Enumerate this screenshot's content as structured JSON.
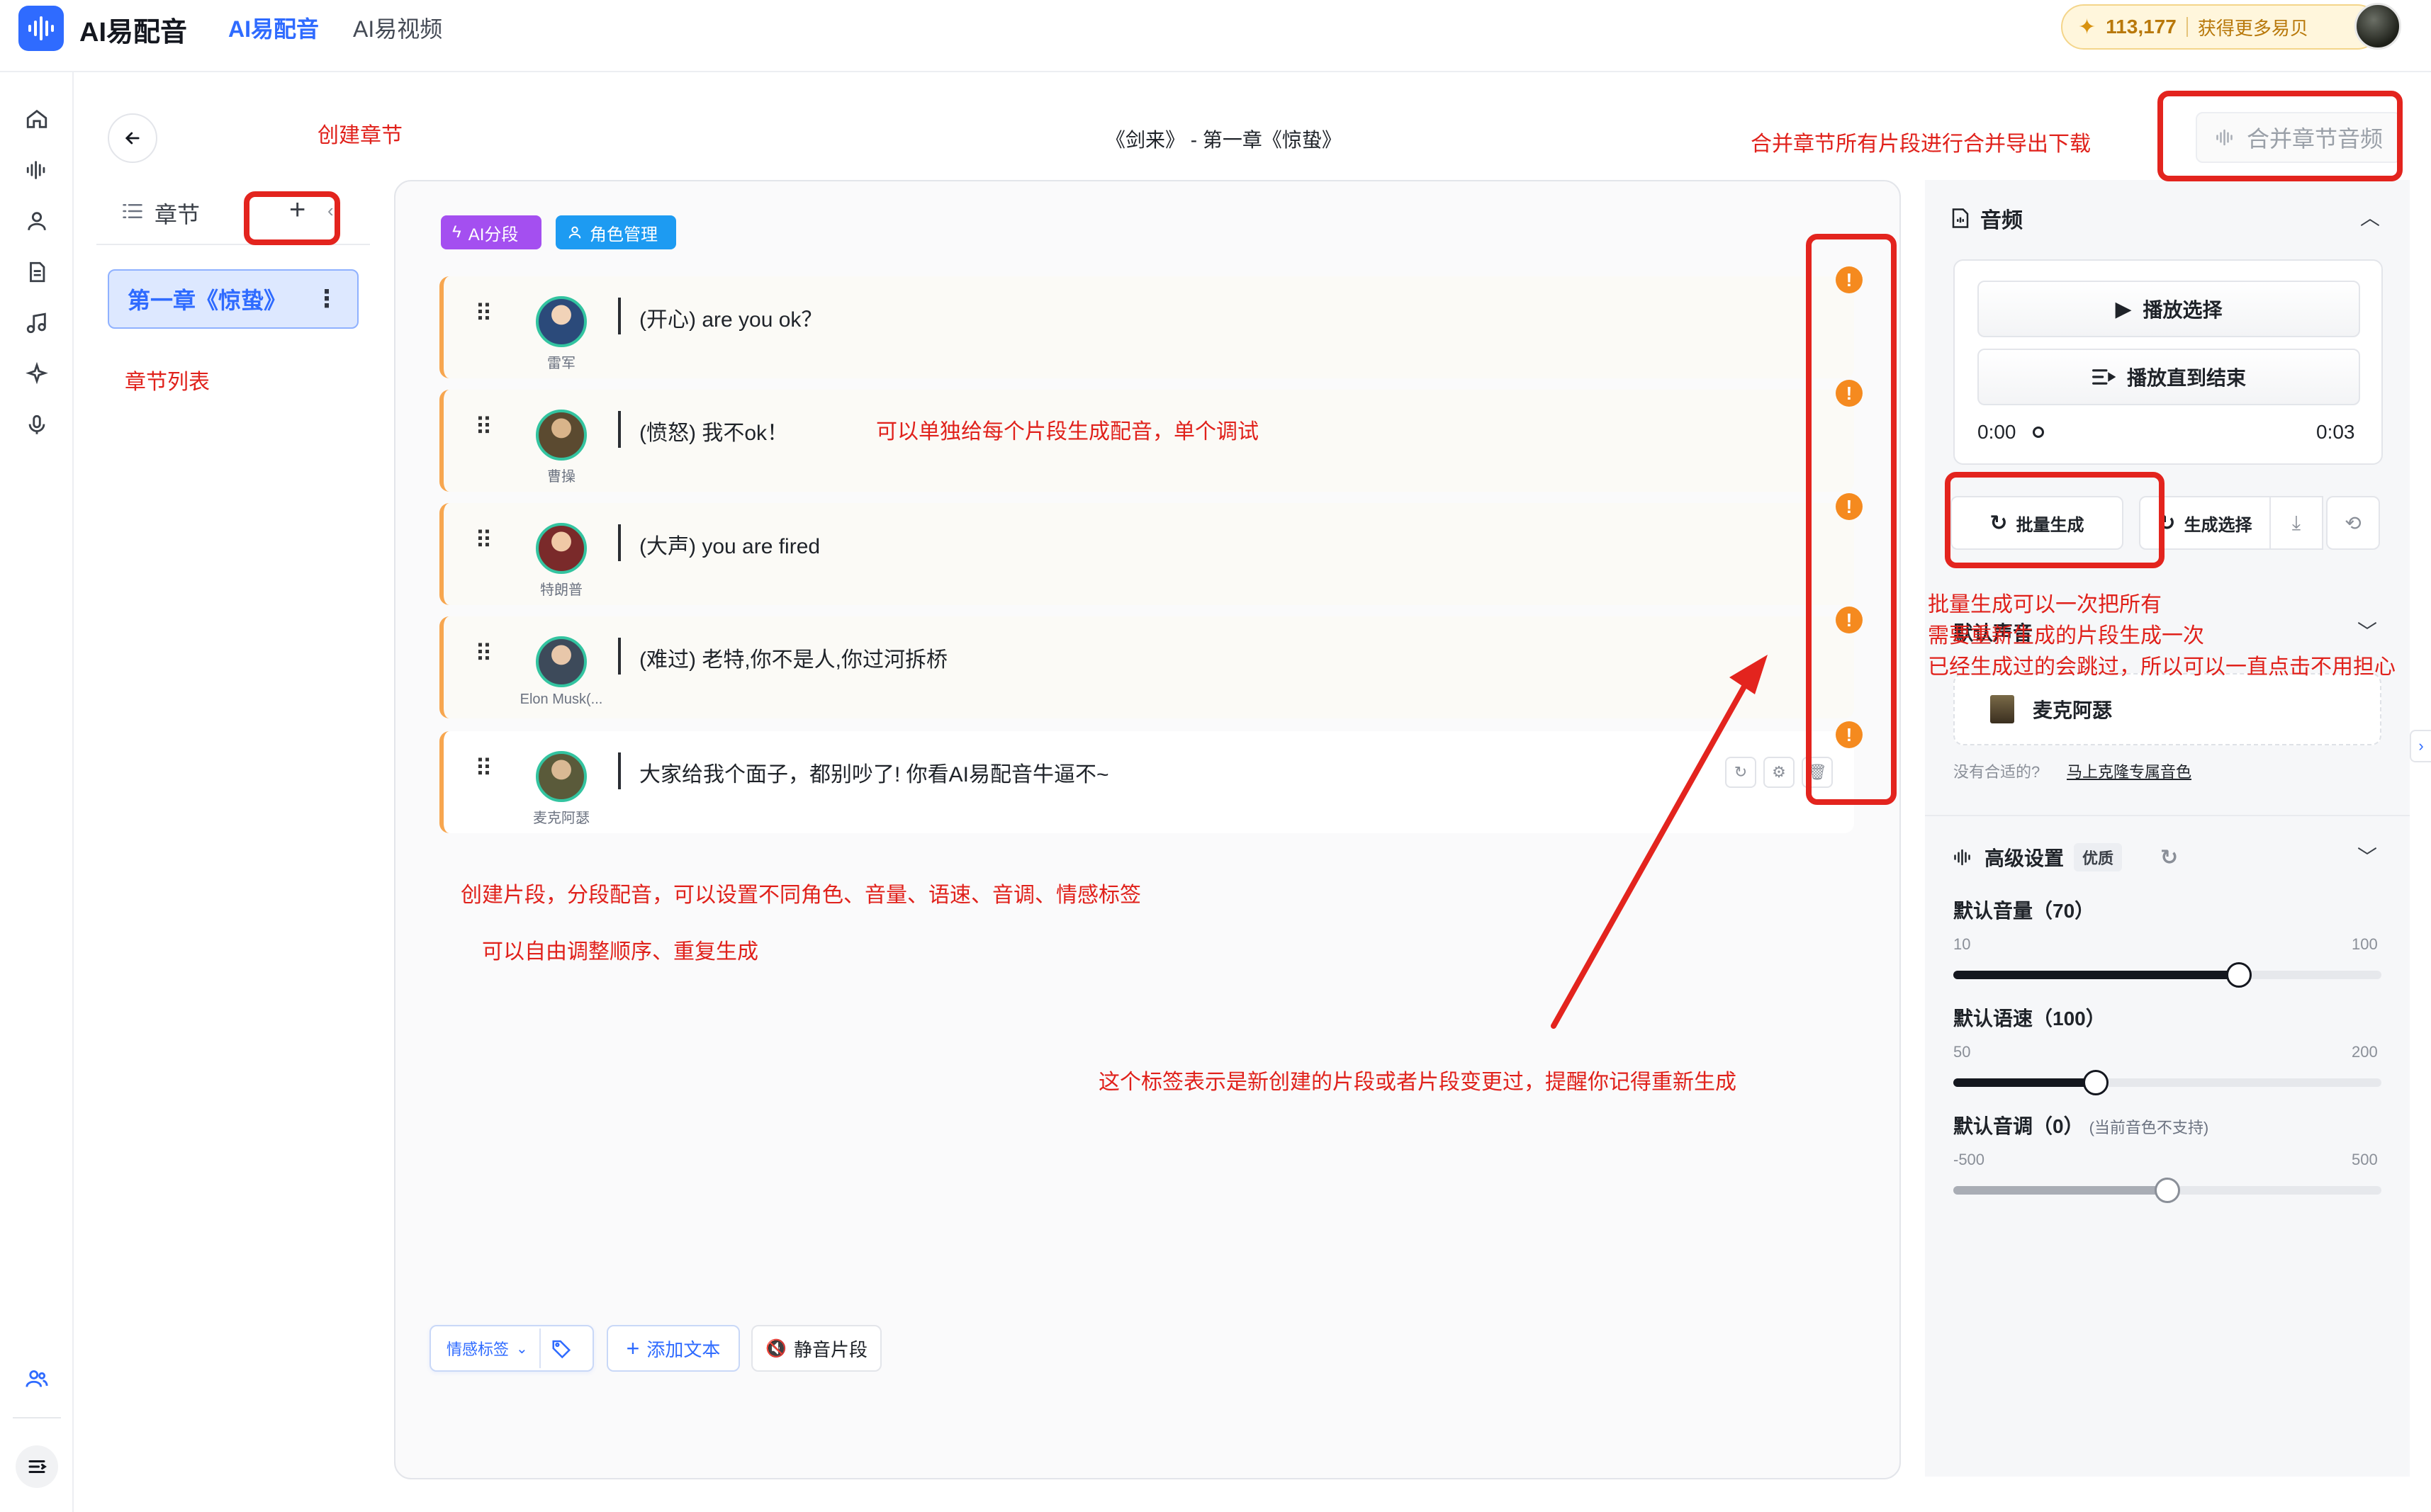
{
  "topbar": {
    "app_name": "AI易配音",
    "tabs": [
      {
        "label": "AI易配音",
        "active": true
      },
      {
        "label": "AI易视频",
        "active": false
      }
    ],
    "coins": "113,177",
    "get_more": "获得更多易贝",
    "accent": "#2f6bff"
  },
  "rail": {
    "icons": [
      "home-icon",
      "waveform-icon",
      "user-icon",
      "document-icon",
      "music-icon",
      "sparkle-icon",
      "mic-icon",
      "team-icon",
      "menu-icon"
    ]
  },
  "chapters": {
    "header": "章节",
    "items": [
      {
        "title": "第一章《惊蛰》",
        "active": true
      }
    ]
  },
  "editor": {
    "title": "《剑来》 - 第一章《惊蛰》",
    "merge_button": "合并章节音频",
    "pills": {
      "ai_segment": "AI分段",
      "role_manage": "角色管理"
    },
    "segments": [
      {
        "speaker": "雷军",
        "text": "(开心) are you ok？",
        "avatar_color": "#2b4a7a"
      },
      {
        "speaker": "曹操",
        "text": "(愤怒) 我不ok！",
        "avatar_color": "#5b4a30"
      },
      {
        "speaker": "特朗普",
        "text": "(大声) you are fired",
        "avatar_color": "#7a2a2a"
      },
      {
        "speaker": "Elon Musk(...",
        "text": "(难过) 老特,你不是人,你过河拆桥",
        "avatar_color": "#3d4a5a"
      },
      {
        "speaker": "麦克阿瑟",
        "text": "大家给我个面子，都别吵了! 你看AI易配音牛逼不~",
        "avatar_color": "#5a5a3a"
      }
    ],
    "warn_symbol": "!",
    "warn_color": "#f58a1f",
    "bottom": {
      "emotion_tag": "情感标签",
      "add_text": "添加文本",
      "mute_segment": "静音片段"
    }
  },
  "right_panel": {
    "audio_title": "音频",
    "play_selection": "播放选择",
    "play_to_end": "播放直到结束",
    "time_start": "0:00",
    "time_end": "0:03",
    "batch_generate": "批量生成",
    "generate_selection": "生成选择",
    "voice_section_title": "默认声音",
    "voice_name": "麦克阿瑟",
    "no_suitable": "没有合适的?",
    "clone_link": "马上克隆专属音色",
    "advanced_title": "高级设置",
    "quality_badge": "优质",
    "sliders": [
      {
        "label": "默认音量（70）",
        "note": "",
        "min": "10",
        "max": "100",
        "value": 70,
        "min_v": 10,
        "max_v": 100,
        "disabled": false
      },
      {
        "label": "默认语速（100）",
        "note": "",
        "min": "50",
        "max": "200",
        "value": 100,
        "min_v": 50,
        "max_v": 200,
        "disabled": false
      },
      {
        "label": "默认音调（0）",
        "note": "(当前音色不支持)",
        "min": "-500",
        "max": "500",
        "value": 0,
        "min_v": -500,
        "max_v": 500,
        "disabled": true
      }
    ]
  },
  "annotations": {
    "create_chapter": "创建章节",
    "chapter_list": "章节列表",
    "merge_note": "合并章节所有片段进行合并导出下载",
    "single_note": "可以单独给每个片段生成配音，单个调试",
    "batch_line1": "批量生成可以一次把所有",
    "batch_line2": "需要重新生成的片段生成一次",
    "batch_line3": "已经生成过的会跳过，所以可以一直点击不用担心",
    "create_segment": "创建片段，分段配音，可以设置不同角色、音量、语速、音调、情感标签",
    "reorder": "可以自由调整顺序、重复生成",
    "tag_note": "这个标签表示是新创建的片段或者片段变更过，提醒你记得重新生成",
    "color": "#e0211b"
  }
}
